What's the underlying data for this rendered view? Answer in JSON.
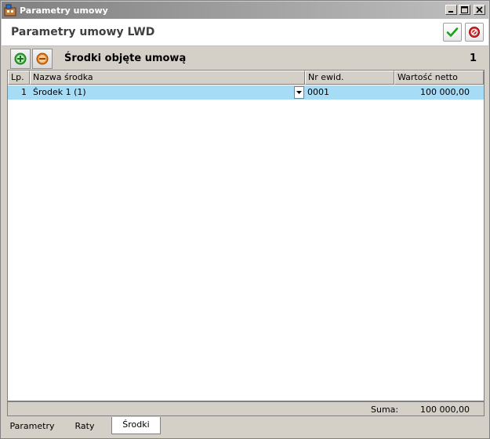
{
  "window": {
    "title": "Parametry umowy"
  },
  "header": {
    "title": "Parametry umowy LWD"
  },
  "section": {
    "title": "Środki objęte umową",
    "count": "1"
  },
  "table": {
    "columns": [
      "Lp.",
      "Nazwa środka",
      "Nr ewid.",
      "Wartość netto"
    ],
    "rows": [
      {
        "lp": "1",
        "name": "Środek 1 (1)",
        "nr_ewid": "0001",
        "value": "100 000,00"
      }
    ]
  },
  "footer": {
    "sum_label": "Suma:",
    "sum_value": "100 000,00"
  },
  "tabs": [
    {
      "label": "Parametry",
      "active": false
    },
    {
      "label": "Raty",
      "active": false
    },
    {
      "label": "Środki",
      "active": true
    }
  ],
  "colors": {
    "selected_row": "#a6dcf6",
    "ok_green": "#1e9e1e",
    "cancel_red": "#d02828",
    "add_green": "#3aa83a",
    "remove_orange": "#e07a1a"
  }
}
